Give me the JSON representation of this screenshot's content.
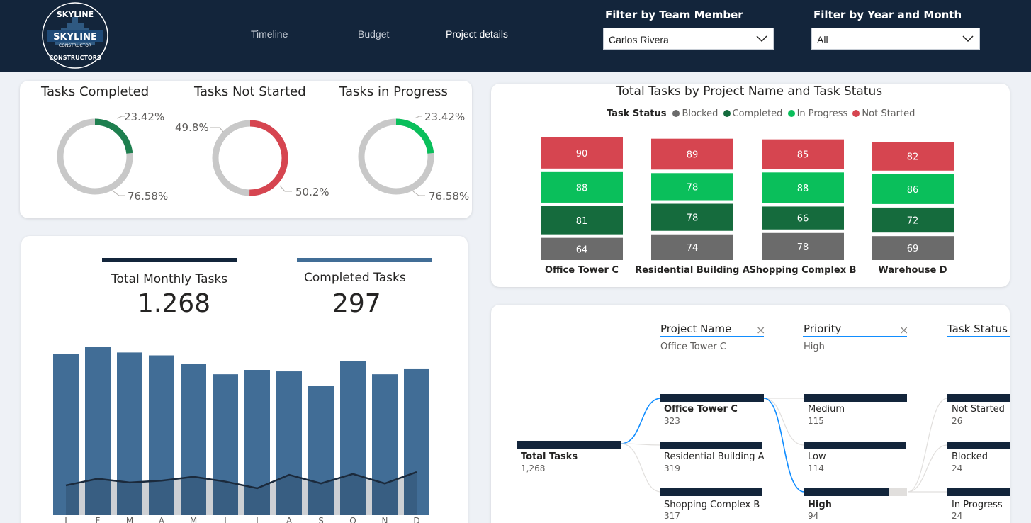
{
  "header": {
    "brand_top": "SKYLINE",
    "brand_main": "SKYLINE",
    "brand_sub1": "CONSTRUCTOR",
    "brand_sub2": "CONSTRUCTORS",
    "nav": [
      {
        "label": "Timeline",
        "active": false
      },
      {
        "label": "Budget",
        "active": false
      },
      {
        "label": "Project details",
        "active": true
      }
    ],
    "filter_member_label": "Filter by Team Member",
    "filter_member_value": "Carlos Rivera",
    "filter_date_label": "Filter by Year and Month",
    "filter_date_value": "All"
  },
  "donuts": [
    {
      "title": "Tasks Completed",
      "highlight": 23.42,
      "rest": 76.58,
      "highlight_label": "23.42%",
      "rest_label": "76.58%",
      "color": "#1e7f4f"
    },
    {
      "title": "Tasks Not Started",
      "highlight": 50.2,
      "rest": 49.8,
      "highlight_label": "50.2%",
      "rest_label": "49.8%",
      "color": "#d64550"
    },
    {
      "title": "Tasks in Progress",
      "highlight": 23.42,
      "rest": 76.58,
      "highlight_label": "23.42%",
      "rest_label": "76.58%",
      "color": "#0abf5b"
    }
  ],
  "kpis": {
    "total_label": "Total Monthly Tasks",
    "total_value": "1.268",
    "completed_label": "Completed Tasks",
    "completed_value": "297"
  },
  "monthly_chart": {
    "type": "bar",
    "categories": [
      "J",
      "F",
      "M",
      "A",
      "M",
      "J",
      "J",
      "A",
      "S",
      "O",
      "N",
      "D"
    ],
    "bar_color": "#416d96",
    "line_color": "#1b2a3c",
    "bars": [
      111,
      120,
      112,
      110,
      104,
      97,
      100,
      99,
      89,
      106,
      97,
      101
    ],
    "line": [
      20,
      27,
      23,
      25,
      29,
      24,
      17,
      31,
      22,
      32,
      22,
      34
    ]
  },
  "status_chart": {
    "title": "Total Tasks by Project Name and Task Status",
    "legend_title": "Task Status",
    "legend": [
      {
        "name": "Blocked",
        "color": "#6b6b6b"
      },
      {
        "name": "Completed",
        "color": "#156b3d"
      },
      {
        "name": "In Progress",
        "color": "#0abf5b"
      },
      {
        "name": "Not Started",
        "color": "#d64550"
      }
    ],
    "projects": [
      {
        "name": "Office Tower C",
        "blocked": 64,
        "completed": 81,
        "in_progress": 88,
        "not_started": 90
      },
      {
        "name": "Residential Building A",
        "blocked": 74,
        "completed": 78,
        "in_progress": 78,
        "not_started": 89
      },
      {
        "name": "Shopping Complex B",
        "blocked": 78,
        "completed": 66,
        "in_progress": 88,
        "not_started": 85
      },
      {
        "name": "Warehouse D",
        "blocked": 69,
        "completed": 72,
        "in_progress": 86,
        "not_started": 82
      }
    ]
  },
  "tree": {
    "levels": [
      {
        "header": "Project Name",
        "selection": "Office Tower C",
        "closable": true
      },
      {
        "header": "Priority",
        "selection": "High",
        "closable": true
      },
      {
        "header": "Task Status",
        "selection": "",
        "closable": false
      }
    ],
    "root": {
      "label": "Total Tasks",
      "value": "1,268"
    },
    "projects": [
      {
        "label": "Office Tower C",
        "value": "323",
        "selected": true
      },
      {
        "label": "Residential Building A",
        "value": "319",
        "selected": false
      },
      {
        "label": "Shopping Complex B",
        "value": "317",
        "selected": false
      }
    ],
    "priorities": [
      {
        "label": "Medium",
        "value": "115",
        "selected": false
      },
      {
        "label": "Low",
        "value": "114",
        "selected": false
      },
      {
        "label": "High",
        "value": "94",
        "selected": true
      }
    ],
    "statuses": [
      {
        "label": "Not Started",
        "value": "26"
      },
      {
        "label": "Blocked",
        "value": "24"
      },
      {
        "label": "In Progress",
        "value": "24"
      }
    ]
  }
}
